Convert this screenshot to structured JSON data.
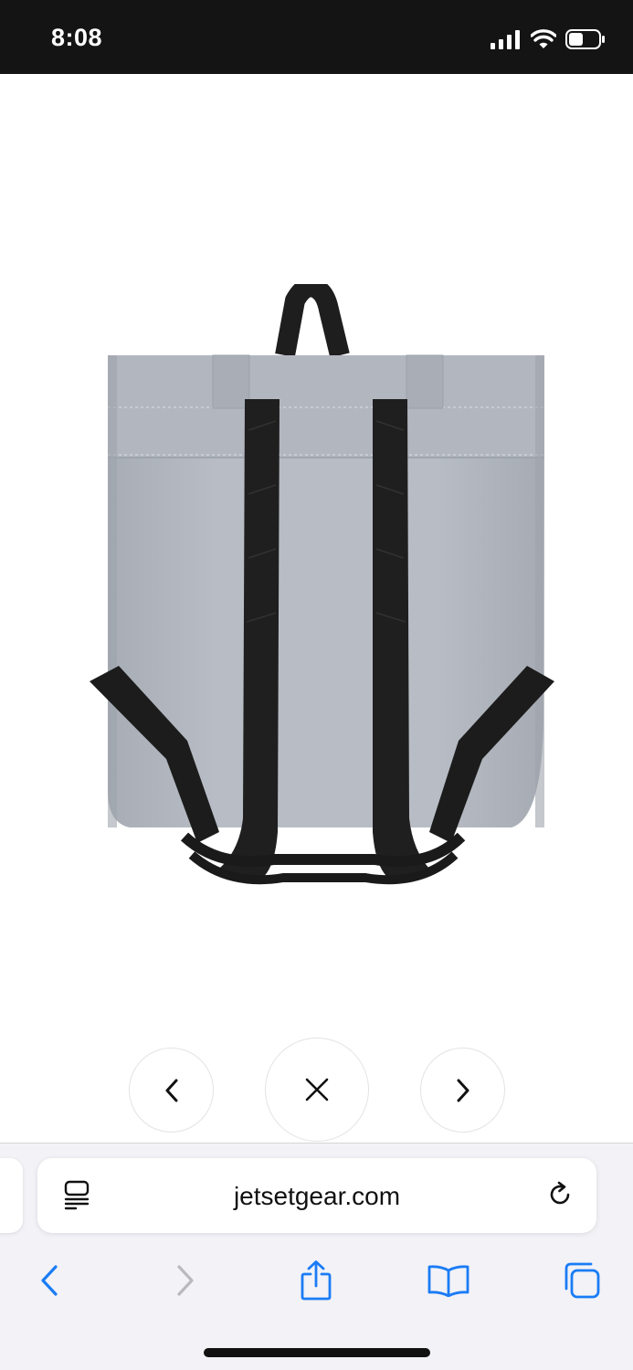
{
  "status_bar": {
    "time": "8:08",
    "icons": [
      "cellular-signal-icon",
      "wifi-icon",
      "battery-icon"
    ]
  },
  "product": {
    "image": "grey-rolltop-backpack-back-view"
  },
  "gallery_controls": {
    "previous": "chevron-left-icon",
    "close": "close-icon",
    "next": "chevron-right-icon"
  },
  "browser": {
    "url": "jetsetgear.com",
    "toolbar": [
      "back-icon",
      "forward-icon",
      "share-icon",
      "bookmarks-icon",
      "tabs-icon"
    ],
    "accent_color": "#1a7cf5"
  }
}
